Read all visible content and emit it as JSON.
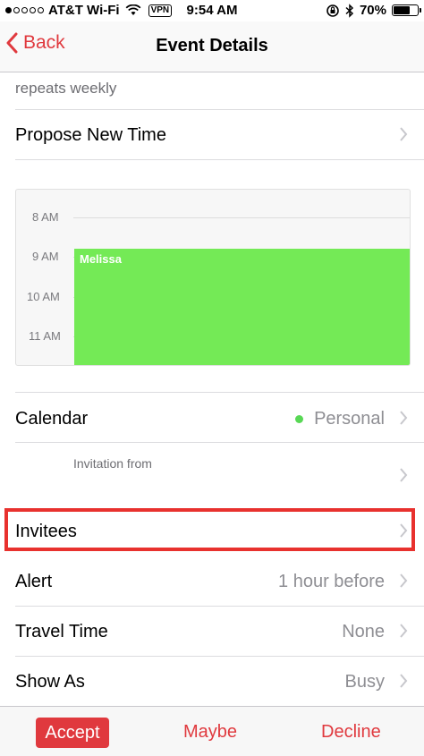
{
  "status_bar": {
    "carrier": "AT&T Wi-Fi",
    "vpn": "VPN",
    "time": "9:54 AM",
    "battery": "70%",
    "battery_level": 0.7,
    "signal_bars": 1
  },
  "nav": {
    "back_label": "Back",
    "title": "Event Details"
  },
  "details": {
    "repeats": "repeats weekly",
    "propose_label": "Propose New Time"
  },
  "calendar_preview": {
    "hours": [
      "8 AM",
      "9 AM",
      "10 AM",
      "11 AM"
    ],
    "event_name": "Melissa",
    "event_color": "#74ea56"
  },
  "rows": {
    "calendar_label": "Calendar",
    "calendar_value": "Personal",
    "calendar_color": "#58d855",
    "invitation_from": "Invitation from",
    "invitees_label": "Invitees",
    "alert_label": "Alert",
    "alert_value": "1 hour before",
    "travel_label": "Travel Time",
    "travel_value": "None",
    "show_as_label": "Show As",
    "show_as_value": "Busy"
  },
  "actions": {
    "accept": "Accept",
    "maybe": "Maybe",
    "decline": "Decline"
  },
  "colors": {
    "accent": "#e0393e",
    "highlight": "#e8312e"
  }
}
